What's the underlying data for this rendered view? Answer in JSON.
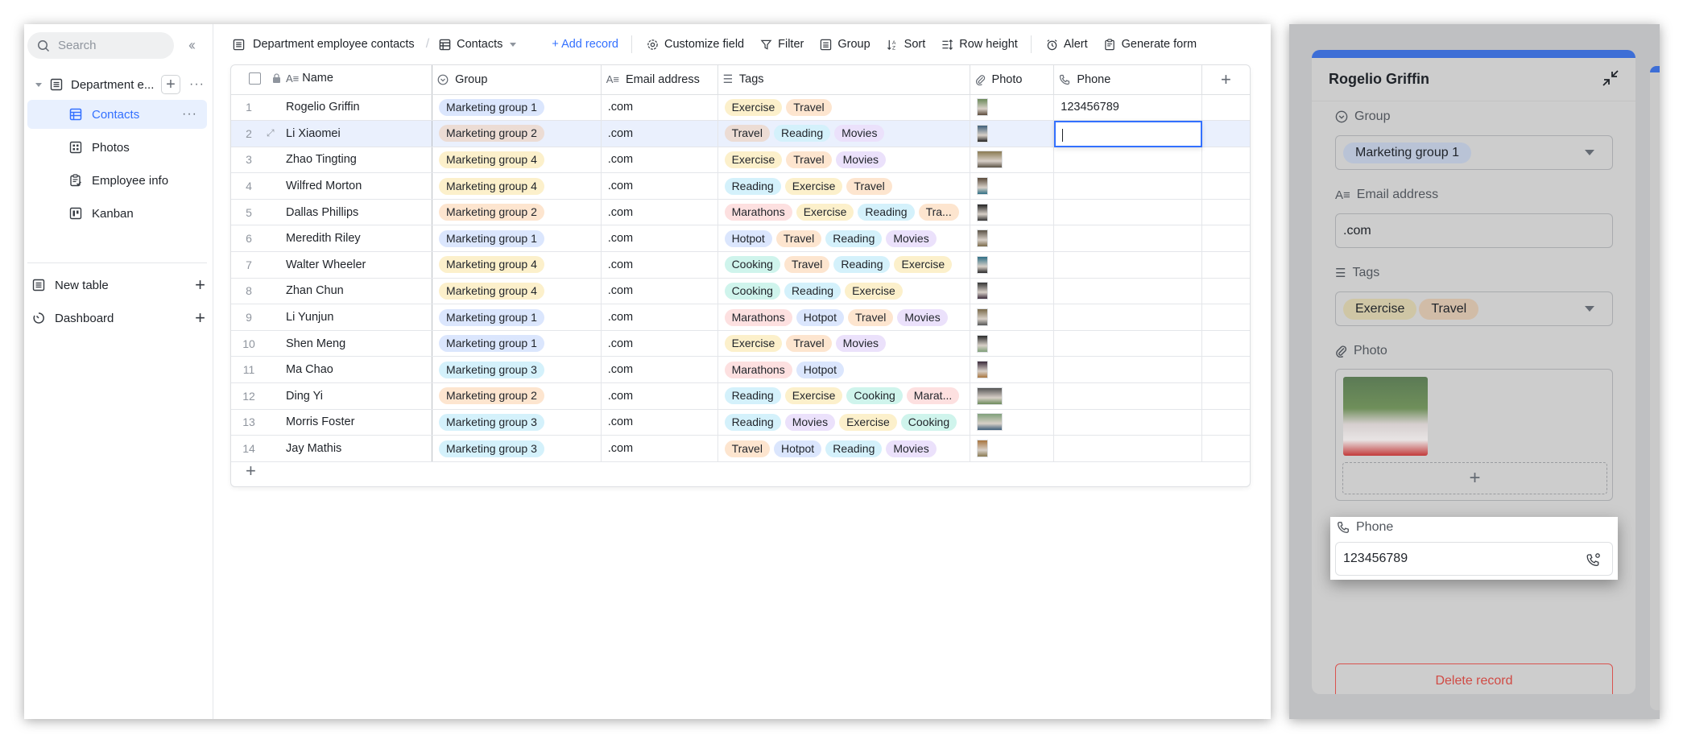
{
  "sidebar": {
    "search_placeholder": "Search",
    "collapse_icon": "double-chevron-left",
    "base_name": "Department e...",
    "views": [
      {
        "label": "Contacts",
        "icon": "grid-table-icon",
        "active": true
      },
      {
        "label": "Photos",
        "icon": "gallery-icon",
        "active": false
      },
      {
        "label": "Employee info",
        "icon": "form-icon",
        "active": false
      },
      {
        "label": "Kanban",
        "icon": "kanban-icon",
        "active": false
      }
    ],
    "sections": [
      {
        "label": "New table",
        "icon": "table-icon"
      },
      {
        "label": "Dashboard",
        "icon": "dashboard-icon"
      }
    ]
  },
  "toolbar": {
    "table_name": "Department employee contacts",
    "separator": "/",
    "view_name": "Contacts",
    "add_record": "+ Add record",
    "customize_field": "Customize field",
    "filter": "Filter",
    "group": "Group",
    "sort": "Sort",
    "row_height": "Row height",
    "alert": "Alert",
    "generate_form": "Generate form"
  },
  "table": {
    "columns": [
      "Name",
      "Group",
      "Email address",
      "Tags",
      "Photo",
      "Phone"
    ],
    "group_colors": {
      "Marketing group 1": "#dbe6fd",
      "Marketing group 2": "#fde5cf",
      "Marketing group 3": "#d4f1fb",
      "Marketing group 4": "#fcf0cb"
    },
    "tag_colors": {
      "Exercise": "#fcf0cb",
      "Travel": "#fde5cf",
      "Reading": "#d4f1fb",
      "Movies": "#ebe1fb",
      "Marathons": "#fde0e0",
      "Hotpot": "#dbe6fd",
      "Cooking": "#cff4ec",
      "Tra...": "#fde5cf",
      "Marat...": "#fde0e0"
    },
    "rows": [
      {
        "n": "1",
        "name": "Rogelio Griffin",
        "group": "Marketing group 1",
        "email": ".com",
        "tags": [
          "Exercise",
          "Travel"
        ],
        "photo": "portrait",
        "phone": "123456789"
      },
      {
        "n": "2",
        "name": "Li Xiaomei",
        "group": "Marketing group 2",
        "email": ".com",
        "tags": [
          "Travel",
          "Reading",
          "Movies"
        ],
        "photo": "portrait",
        "phone": ""
      },
      {
        "n": "3",
        "name": "Zhao Tingting",
        "group": "Marketing group 4",
        "email": ".com",
        "tags": [
          "Exercise",
          "Travel",
          "Movies"
        ],
        "photo": "landscape",
        "phone": ""
      },
      {
        "n": "4",
        "name": "Wilfred Morton",
        "group": "Marketing group 4",
        "email": ".com",
        "tags": [
          "Reading",
          "Exercise",
          "Travel"
        ],
        "photo": "portrait",
        "phone": ""
      },
      {
        "n": "5",
        "name": "Dallas Phillips",
        "group": "Marketing group 2",
        "email": ".com",
        "tags": [
          "Marathons",
          "Exercise",
          "Reading",
          "Tra..."
        ],
        "photo": "portrait",
        "phone": ""
      },
      {
        "n": "6",
        "name": "Meredith Riley",
        "group": "Marketing group 1",
        "email": ".com",
        "tags": [
          "Hotpot",
          "Travel",
          "Reading",
          "Movies"
        ],
        "photo": "portrait",
        "phone": ""
      },
      {
        "n": "7",
        "name": "Walter Wheeler",
        "group": "Marketing group 4",
        "email": ".com",
        "tags": [
          "Cooking",
          "Travel",
          "Reading",
          "Exercise"
        ],
        "photo": "portrait",
        "phone": ""
      },
      {
        "n": "8",
        "name": "Zhan Chun",
        "group": "Marketing group 4",
        "email": ".com",
        "tags": [
          "Cooking",
          "Reading",
          "Exercise"
        ],
        "photo": "portrait",
        "phone": ""
      },
      {
        "n": "9",
        "name": "Li Yunjun",
        "group": "Marketing group 1",
        "email": ".com",
        "tags": [
          "Marathons",
          "Hotpot",
          "Travel",
          "Movies"
        ],
        "photo": "portrait",
        "phone": ""
      },
      {
        "n": "10",
        "name": "Shen Meng",
        "group": "Marketing group 1",
        "email": ".com",
        "tags": [
          "Exercise",
          "Travel",
          "Movies"
        ],
        "photo": "portrait",
        "phone": ""
      },
      {
        "n": "11",
        "name": "Ma Chao",
        "group": "Marketing group 3",
        "email": ".com",
        "tags": [
          "Marathons",
          "Hotpot"
        ],
        "photo": "portrait",
        "phone": ""
      },
      {
        "n": "12",
        "name": "Ding Yi",
        "group": "Marketing group 2",
        "email": ".com",
        "tags": [
          "Reading",
          "Exercise",
          "Cooking",
          "Marat..."
        ],
        "photo": "landscape",
        "phone": ""
      },
      {
        "n": "13",
        "name": "Morris Foster",
        "group": "Marketing group 3",
        "email": ".com",
        "tags": [
          "Reading",
          "Movies",
          "Exercise",
          "Cooking"
        ],
        "photo": "landscape",
        "phone": ""
      },
      {
        "n": "14",
        "name": "Jay Mathis",
        "group": "Marketing group 3",
        "email": ".com",
        "tags": [
          "Travel",
          "Hotpot",
          "Reading",
          "Movies"
        ],
        "photo": "portrait",
        "phone": ""
      }
    ],
    "selected_row": "2",
    "editing_cell": "Phone"
  },
  "record_panel": {
    "title": "Rogelio Griffin",
    "fields": {
      "group_label": "Group",
      "group_value": "Marketing group 1",
      "email_label": "Email address",
      "email_value": ".com",
      "tags_label": "Tags",
      "tags_values": [
        "Exercise",
        "Travel"
      ],
      "photo_label": "Photo",
      "phone_label": "Phone",
      "phone_value": "123456789"
    },
    "delete_label": "Delete record",
    "accent_color": "#3d6ed6",
    "danger_color": "#d04a44"
  }
}
